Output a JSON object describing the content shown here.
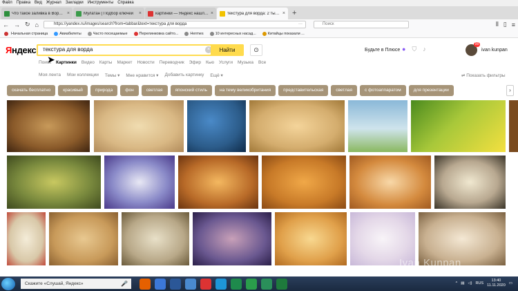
{
  "menubar": [
    "Файл",
    "Правка",
    "Вид",
    "Журнал",
    "Закладки",
    "Инструменты",
    "Справка"
  ],
  "tabs": [
    {
      "title": "Что такое заливка в Ворде (И...",
      "color": "#2d8f3c",
      "active": false
    },
    {
      "title": "Мулатан | Подбор ключей",
      "color": "#3a9b4a",
      "active": false
    },
    {
      "title": "картинки — Яндекс нашлос...",
      "color": "#d33",
      "active": false
    },
    {
      "title": "текстура для ворда: 2 тыс изо...",
      "color": "#f2c200",
      "active": true
    }
  ],
  "newtab_symbol": "+",
  "url": "https://yandex.ru/images/search?from=tabbar&text=текстура для ворда",
  "url_dots": "···",
  "browser_search_placeholder": "Поиск",
  "bookmarks": [
    {
      "label": "Начальная страница",
      "color": "#c33"
    },
    {
      "label": "Авиабилеты",
      "color": "#39f"
    },
    {
      "label": "Часто посещаемые",
      "color": "#999"
    },
    {
      "label": "Перелинковка сайто...",
      "color": "#d33"
    },
    {
      "label": "Hermes",
      "color": "#888"
    },
    {
      "label": "10 интересных насад...",
      "color": "#888"
    },
    {
      "label": "Китайцы показали ...",
      "color": "#d90"
    }
  ],
  "yandex": {
    "logo_first": "Я",
    "logo_rest": "ндекс",
    "query": "текстура для ворда",
    "clear_symbol": "×",
    "search_button": "Найти",
    "camera_symbol": "⊙",
    "plus_label": "Будьте в Плюсе",
    "notifications_count": "99",
    "username": "ivan kunpan",
    "service_tabs": [
      "Поиск",
      "Картинки",
      "Видео",
      "Карты",
      "Маркет",
      "Новости",
      "Переводчик",
      "Эфир",
      "Кью",
      "Услуги",
      "Музыка",
      "Все"
    ],
    "active_service_tab": "Картинки",
    "subnav": [
      "Моя лента",
      "Мои коллекции",
      "Темы ▾",
      "Мне нравится ▾",
      "Добавить картинку",
      "Ещё ▾"
    ],
    "show_filters": "⇌ Показать фильтры",
    "chips": [
      "скачать бесплатно",
      "красивый",
      "природа",
      "фон",
      "светлая",
      "японский стиль",
      "на тему великобритания",
      "представительская",
      "светлая",
      "с фотоаппаратом",
      "для презентации"
    ],
    "chips_next": "›"
  },
  "watermark": "Ivan Kunpan",
  "taskbar": {
    "search_text": "Скажите «Слушай, Яндекс»",
    "mic_symbol": "🎤",
    "apps": [
      "#e66000",
      "#3c78d8",
      "#2b5797",
      "#4a8ad0",
      "#d33",
      "#1e96d8",
      "#1e8a4c",
      "#2a9d4b",
      "#2a8f5a",
      "#1e7a3c"
    ],
    "lang": "RUS",
    "time": "13:40",
    "date": "11.11.2020"
  },
  "tile_colors": {
    "row1": [
      "#8a5a2a",
      "#d9b884",
      "#2c5c8a",
      "#d4ad6e",
      "#a9cbd8",
      "#a8c83a",
      "#7a4a1e"
    ],
    "row2": [
      "#7a8a3e",
      "#8a8ac8",
      "#b86a28",
      "#c87a28",
      "#d48a3e",
      "#b8a890"
    ],
    "row3": [
      "#d8c8a8",
      "#c89a5a",
      "#b8a888",
      "#6a5890",
      "#e0a04a",
      "#e4d8e8",
      "#c8b090"
    ],
    "row4": [
      "#c8a878",
      "#c89a6a",
      "#d8c8a8",
      "#a88a5a",
      "#c8a878",
      "#8aa8c8",
      "#c87a3a"
    ]
  }
}
